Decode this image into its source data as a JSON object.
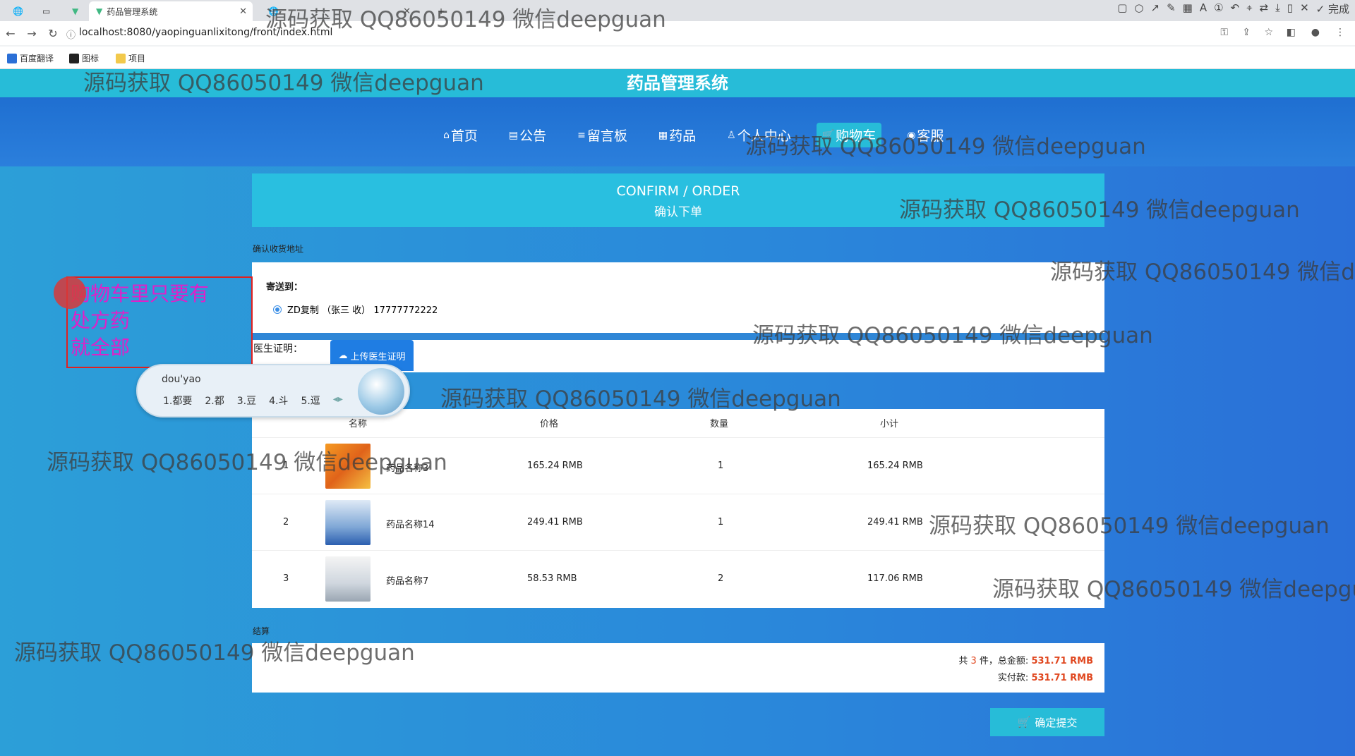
{
  "browser": {
    "tabs": [
      {
        "title": ""
      },
      {
        "title": ""
      },
      {
        "title": "药品管理系统"
      },
      {
        "title": ""
      },
      {
        "title": ""
      }
    ],
    "url": "localhost:8080/yaopinguanlixitong/front/index.html",
    "bookmarks": [
      "百度翻译",
      "图标",
      "项目"
    ],
    "toolbar": {
      "font_size": "22",
      "done_label": "完成"
    },
    "palette_colors": [
      "#ff00ff",
      "#000000",
      "#7f7f7f",
      "#880015",
      "#ed1c24",
      "#ff7f27",
      "#22b14c",
      "#3f48cc",
      "#a349a4",
      "#ffffff",
      "#c3c3c3",
      "#b97a57",
      "#ffaec9",
      "#ffc90e",
      "#b5e61d",
      "#00a2e8"
    ]
  },
  "site": {
    "title": "药品管理系统",
    "nav": [
      {
        "icon": "home-icon",
        "glyph": "⌂",
        "label": "首页"
      },
      {
        "icon": "notice-icon",
        "glyph": "▤",
        "label": "公告"
      },
      {
        "icon": "message-board-icon",
        "glyph": "≡",
        "label": "留言板"
      },
      {
        "icon": "medicine-icon",
        "glyph": "▦",
        "label": "药品"
      },
      {
        "icon": "user-icon",
        "glyph": "♙",
        "label": "个人中心"
      },
      {
        "icon": "cart-icon",
        "glyph": "🛒",
        "label": "购物车"
      },
      {
        "icon": "support-icon",
        "glyph": "◉",
        "label": "客服"
      }
    ]
  },
  "order": {
    "banner_en": "CONFIRM / ORDER",
    "banner_cn": "确认下单",
    "address_section": "确认收货地址",
    "ship_to_label": "寄送到：",
    "address": "ZD复制 （张三 收） 17777772222",
    "cert_label": "医生证明：",
    "upload_label": "上传医生证明",
    "table_headers": [
      "名称",
      "价格",
      "数量",
      "小计"
    ],
    "items": [
      {
        "index": "1",
        "name": "药品名称3",
        "price": "165.24 RMB",
        "qty": "1",
        "subtotal": "165.24 RMB"
      },
      {
        "index": "2",
        "name": "药品名称14",
        "price": "249.41 RMB",
        "qty": "1",
        "subtotal": "249.41 RMB"
      },
      {
        "index": "3",
        "name": "药品名称7",
        "price": "58.53 RMB",
        "qty": "2",
        "subtotal": "117.06 RMB"
      }
    ],
    "settle_label": "结算",
    "summary_prefix": "共",
    "summary_count": "3",
    "summary_mid": "件，总金额:",
    "total": "531.71 RMB",
    "paid_label": "实付款:",
    "paid": "531.71 RMB",
    "submit_label": "确定提交"
  },
  "annotation": {
    "line1": "购物车里只要有",
    "line2": "处方药",
    "line3": "就全部"
  },
  "ime": {
    "pinyin": "dou'yao",
    "candidates": [
      "1.都要",
      "2.都",
      "3.豆",
      "4.斗",
      "5.逗"
    ]
  },
  "watermark": "源码获取 QQ86050149 微信deepguan"
}
